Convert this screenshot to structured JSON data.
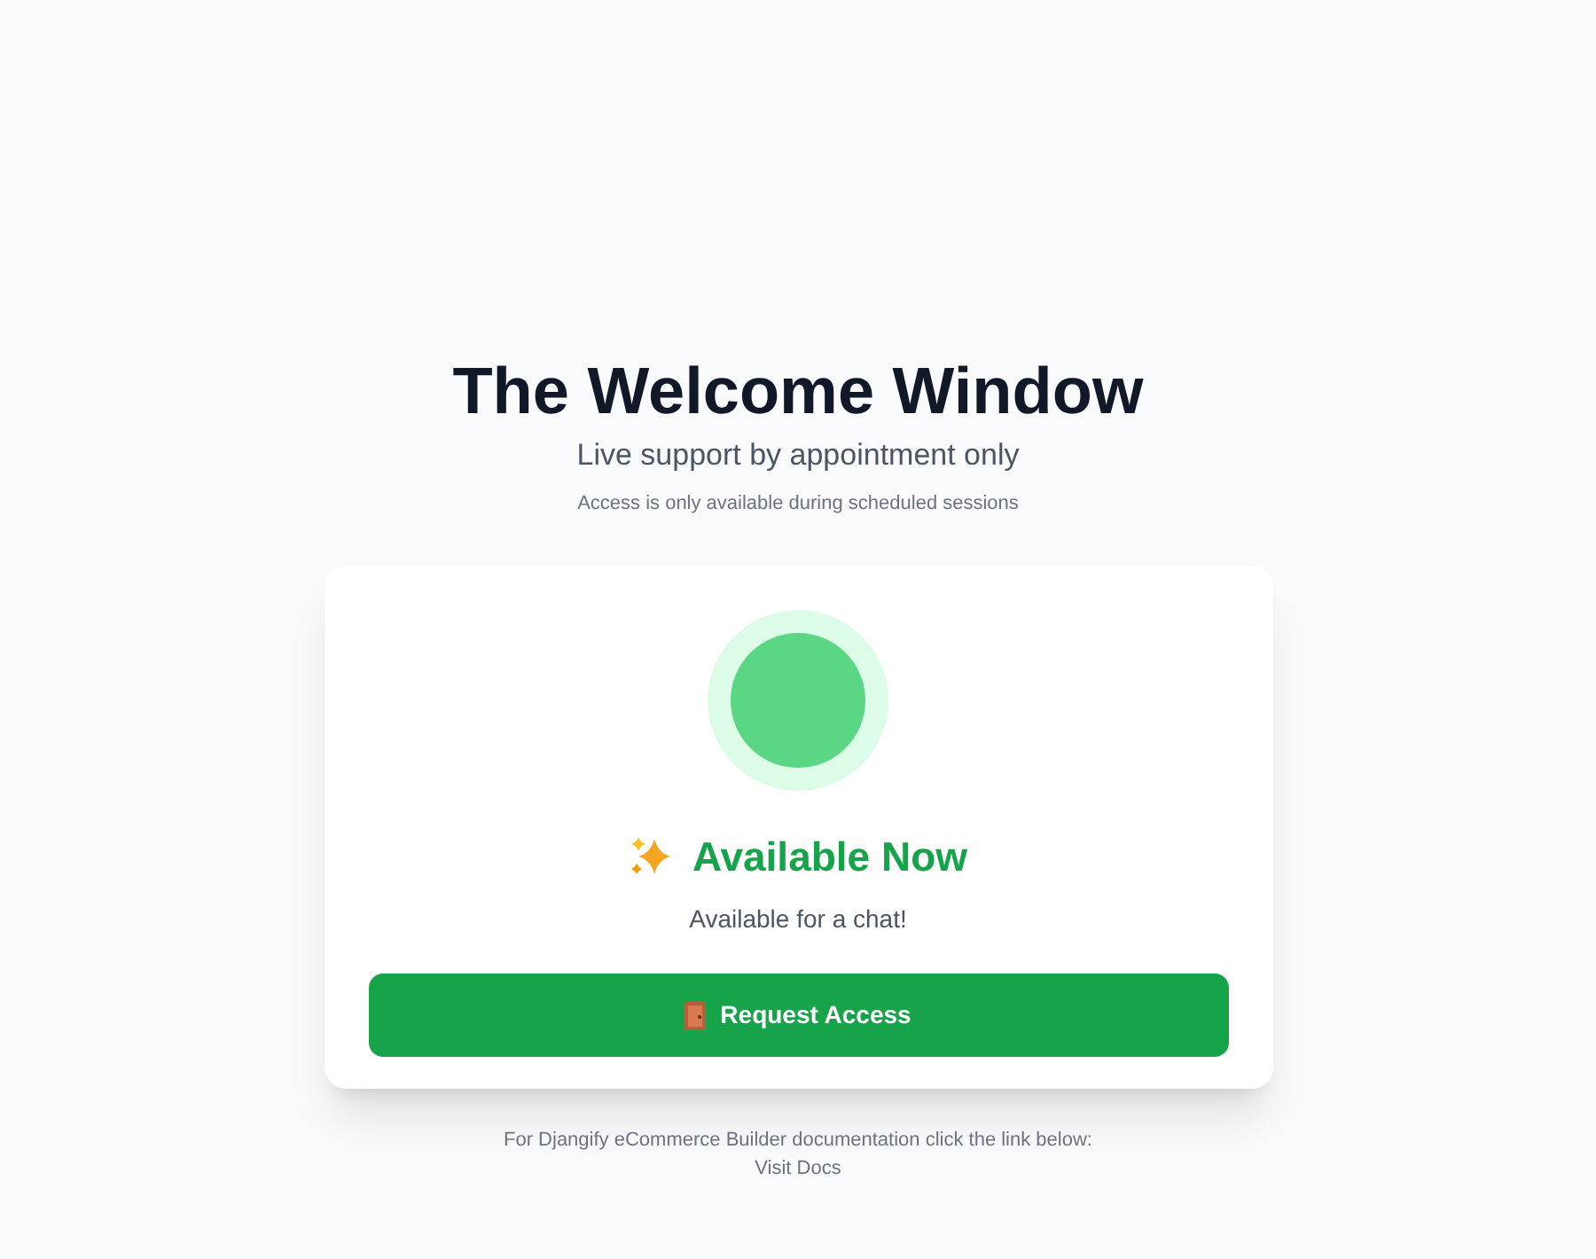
{
  "header": {
    "title": "The Welcome Window",
    "subtitle": "Live support by appointment only",
    "note": "Access is only available during scheduled sessions"
  },
  "status_card": {
    "available": true,
    "heading": "Available Now",
    "message": "Available for a chat!",
    "button": "Request Access"
  },
  "footer": {
    "text": "For Djangify eCommerce Builder documentation click the link below:",
    "link": "Visit Docs"
  }
}
